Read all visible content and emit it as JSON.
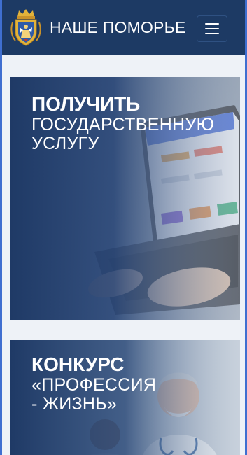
{
  "header": {
    "title": "НАШЕ ПОМОРЬЕ",
    "emblem_icon": "coat-of-arms-icon",
    "menu_icon": "hamburger-menu-icon",
    "background": "#1d3a64"
  },
  "cards": [
    {
      "title_bold": "ПОЛУЧИТЬ",
      "title_line2": "ГОСУДАРСТВЕННУЮ",
      "title_line3": "УСЛУГУ",
      "image": "laptop-hands-photo"
    },
    {
      "title_bold": "КОНКУРС",
      "title_line2": "«ПРОФЕССИЯ",
      "title_line3": "- ЖИЗНЬ»",
      "image": "doctors-photo"
    }
  ],
  "colors": {
    "page_border": "#3f6fd0",
    "card_overlay": "#1f3a66"
  }
}
